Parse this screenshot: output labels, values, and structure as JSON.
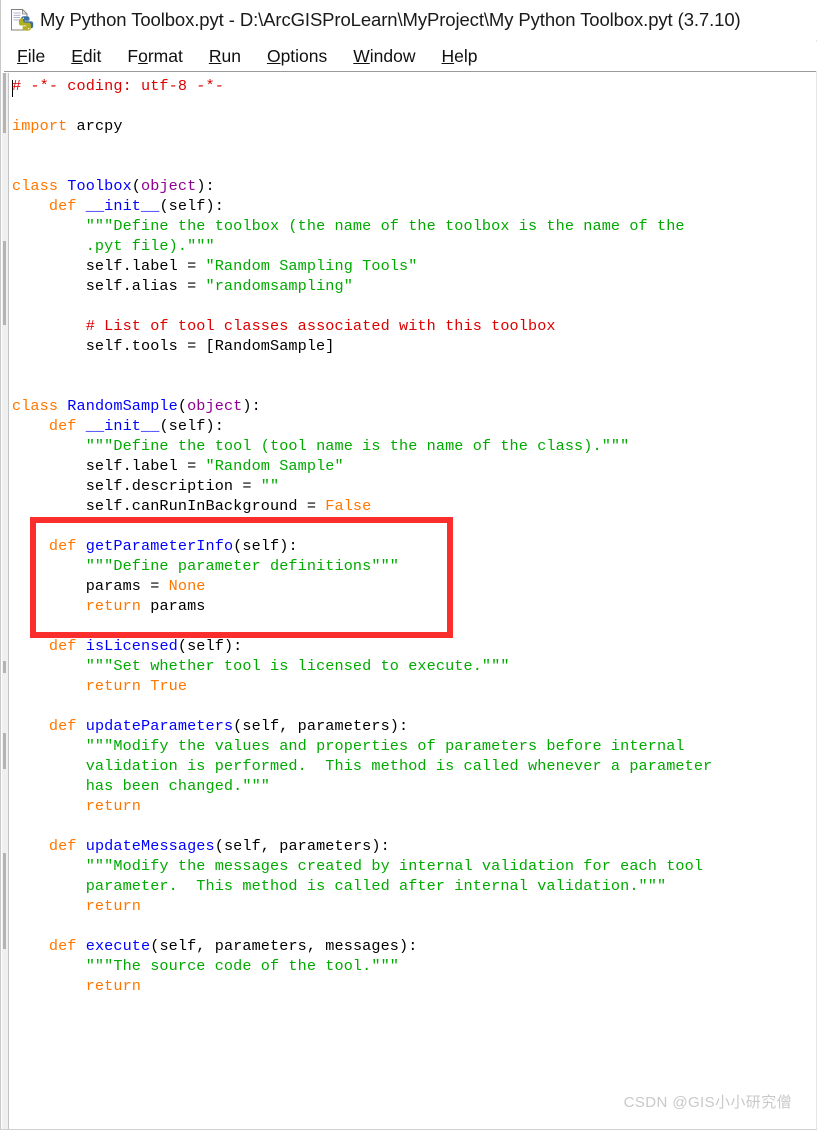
{
  "window": {
    "title": "My Python Toolbox.pyt - D:\\ArcGISProLearn\\MyProject\\My Python Toolbox.pyt (3.7.10)",
    "icon": "python-file-icon"
  },
  "menubar": {
    "items": [
      {
        "label": "File",
        "mnemonic": "F",
        "rest": "ile"
      },
      {
        "label": "Edit",
        "mnemonic": "E",
        "rest": "dit"
      },
      {
        "label": "Format",
        "pre": "F",
        "mnemonic": "o",
        "rest": "rmat"
      },
      {
        "label": "Run",
        "mnemonic": "R",
        "rest": "un"
      },
      {
        "label": "Options",
        "mnemonic": "O",
        "rest": "ptions"
      },
      {
        "label": "Window",
        "mnemonic": "W",
        "rest": "indow"
      },
      {
        "label": "Help",
        "mnemonic": "H",
        "rest": "elp"
      }
    ]
  },
  "editor": {
    "language": "python",
    "colors": {
      "keyword": "#ff7700",
      "definition": "#0000ff",
      "builtin": "#900090",
      "string": "#00aa00",
      "comment": "#dd0000",
      "plain": "#000000",
      "background": "#ffffff"
    },
    "lines": [
      [
        {
          "t": "# -*- coding: utf-8 -*-",
          "c": "c-com"
        }
      ],
      [],
      [
        {
          "t": "import",
          "c": "c-kw"
        },
        {
          "t": " arcpy",
          "c": "c-txt"
        }
      ],
      [],
      [],
      [
        {
          "t": "class",
          "c": "c-kw"
        },
        {
          "t": " ",
          "c": "c-txt"
        },
        {
          "t": "Toolbox",
          "c": "c-def"
        },
        {
          "t": "(",
          "c": "c-txt"
        },
        {
          "t": "object",
          "c": "c-bi"
        },
        {
          "t": "):",
          "c": "c-txt"
        }
      ],
      [
        {
          "t": "    ",
          "c": "c-txt"
        },
        {
          "t": "def",
          "c": "c-kw"
        },
        {
          "t": " ",
          "c": "c-txt"
        },
        {
          "t": "__init__",
          "c": "c-def"
        },
        {
          "t": "(self):",
          "c": "c-txt"
        }
      ],
      [
        {
          "t": "        ",
          "c": "c-txt"
        },
        {
          "t": "\"\"\"Define the toolbox (the name of the toolbox is the name of the",
          "c": "c-str"
        }
      ],
      [
        {
          "t": "        ",
          "c": "c-txt"
        },
        {
          "t": ".pyt file).\"\"\"",
          "c": "c-str"
        }
      ],
      [
        {
          "t": "        self.label = ",
          "c": "c-txt"
        },
        {
          "t": "\"Random Sampling Tools\"",
          "c": "c-str"
        }
      ],
      [
        {
          "t": "        self.alias = ",
          "c": "c-txt"
        },
        {
          "t": "\"randomsampling\"",
          "c": "c-str"
        }
      ],
      [],
      [
        {
          "t": "        ",
          "c": "c-txt"
        },
        {
          "t": "# List of tool classes associated with this toolbox",
          "c": "c-com"
        }
      ],
      [
        {
          "t": "        self.tools = [RandomSample]",
          "c": "c-txt"
        }
      ],
      [],
      [],
      [
        {
          "t": "class",
          "c": "c-kw"
        },
        {
          "t": " ",
          "c": "c-txt"
        },
        {
          "t": "RandomSample",
          "c": "c-def"
        },
        {
          "t": "(",
          "c": "c-txt"
        },
        {
          "t": "object",
          "c": "c-bi"
        },
        {
          "t": "):",
          "c": "c-txt"
        }
      ],
      [
        {
          "t": "    ",
          "c": "c-txt"
        },
        {
          "t": "def",
          "c": "c-kw"
        },
        {
          "t": " ",
          "c": "c-txt"
        },
        {
          "t": "__init__",
          "c": "c-def"
        },
        {
          "t": "(self):",
          "c": "c-txt"
        }
      ],
      [
        {
          "t": "        ",
          "c": "c-txt"
        },
        {
          "t": "\"\"\"Define the tool (tool name is the name of the class).\"\"\"",
          "c": "c-str"
        }
      ],
      [
        {
          "t": "        self.label = ",
          "c": "c-txt"
        },
        {
          "t": "\"Random Sample\"",
          "c": "c-str"
        }
      ],
      [
        {
          "t": "        self.description = ",
          "c": "c-txt"
        },
        {
          "t": "\"\"",
          "c": "c-str"
        }
      ],
      [
        {
          "t": "        self.canRunInBackground = ",
          "c": "c-txt"
        },
        {
          "t": "False",
          "c": "c-kw"
        }
      ],
      [],
      [
        {
          "t": "    ",
          "c": "c-txt"
        },
        {
          "t": "def",
          "c": "c-kw"
        },
        {
          "t": " ",
          "c": "c-txt"
        },
        {
          "t": "getParameterInfo",
          "c": "c-def"
        },
        {
          "t": "(self):",
          "c": "c-txt"
        }
      ],
      [
        {
          "t": "        ",
          "c": "c-txt"
        },
        {
          "t": "\"\"\"Define parameter definitions\"\"\"",
          "c": "c-str"
        }
      ],
      [
        {
          "t": "        params = ",
          "c": "c-txt"
        },
        {
          "t": "None",
          "c": "c-kw"
        }
      ],
      [
        {
          "t": "        ",
          "c": "c-txt"
        },
        {
          "t": "return",
          "c": "c-kw"
        },
        {
          "t": " params",
          "c": "c-txt"
        }
      ],
      [],
      [
        {
          "t": "    ",
          "c": "c-txt"
        },
        {
          "t": "def",
          "c": "c-kw"
        },
        {
          "t": " ",
          "c": "c-txt"
        },
        {
          "t": "isLicensed",
          "c": "c-def"
        },
        {
          "t": "(self):",
          "c": "c-txt"
        }
      ],
      [
        {
          "t": "        ",
          "c": "c-txt"
        },
        {
          "t": "\"\"\"Set whether tool is licensed to execute.\"\"\"",
          "c": "c-str"
        }
      ],
      [
        {
          "t": "        ",
          "c": "c-txt"
        },
        {
          "t": "return",
          "c": "c-kw"
        },
        {
          "t": " ",
          "c": "c-txt"
        },
        {
          "t": "True",
          "c": "c-kw"
        }
      ],
      [],
      [
        {
          "t": "    ",
          "c": "c-txt"
        },
        {
          "t": "def",
          "c": "c-kw"
        },
        {
          "t": " ",
          "c": "c-txt"
        },
        {
          "t": "updateParameters",
          "c": "c-def"
        },
        {
          "t": "(self, parameters):",
          "c": "c-txt"
        }
      ],
      [
        {
          "t": "        ",
          "c": "c-txt"
        },
        {
          "t": "\"\"\"Modify the values and properties of parameters before internal",
          "c": "c-str"
        }
      ],
      [
        {
          "t": "        ",
          "c": "c-txt"
        },
        {
          "t": "validation is performed.  This method is called whenever a parameter",
          "c": "c-str"
        }
      ],
      [
        {
          "t": "        ",
          "c": "c-txt"
        },
        {
          "t": "has been changed.\"\"\"",
          "c": "c-str"
        }
      ],
      [
        {
          "t": "        ",
          "c": "c-txt"
        },
        {
          "t": "return",
          "c": "c-kw"
        }
      ],
      [],
      [
        {
          "t": "    ",
          "c": "c-txt"
        },
        {
          "t": "def",
          "c": "c-kw"
        },
        {
          "t": " ",
          "c": "c-txt"
        },
        {
          "t": "updateMessages",
          "c": "c-def"
        },
        {
          "t": "(self, parameters):",
          "c": "c-txt"
        }
      ],
      [
        {
          "t": "        ",
          "c": "c-txt"
        },
        {
          "t": "\"\"\"Modify the messages created by internal validation for each tool",
          "c": "c-str"
        }
      ],
      [
        {
          "t": "        ",
          "c": "c-txt"
        },
        {
          "t": "parameter.  This method is called after internal validation.\"\"\"",
          "c": "c-str"
        }
      ],
      [
        {
          "t": "        ",
          "c": "c-txt"
        },
        {
          "t": "return",
          "c": "c-kw"
        }
      ],
      [],
      [
        {
          "t": "    ",
          "c": "c-txt"
        },
        {
          "t": "def",
          "c": "c-kw"
        },
        {
          "t": " ",
          "c": "c-txt"
        },
        {
          "t": "execute",
          "c": "c-def"
        },
        {
          "t": "(self, parameters, messages):",
          "c": "c-txt"
        }
      ],
      [
        {
          "t": "        ",
          "c": "c-txt"
        },
        {
          "t": "\"\"\"The source code of the tool.\"\"\"",
          "c": "c-str"
        }
      ],
      [
        {
          "t": "        ",
          "c": "c-txt"
        },
        {
          "t": "return",
          "c": "c-kw"
        }
      ]
    ]
  },
  "annotation": {
    "highlight_box": {
      "color": "#fb2e2e",
      "covers": "getParameterInfo method block"
    }
  },
  "watermark": {
    "text": "CSDN @GIS小小研究僧",
    "color": "#c9c9c9"
  }
}
